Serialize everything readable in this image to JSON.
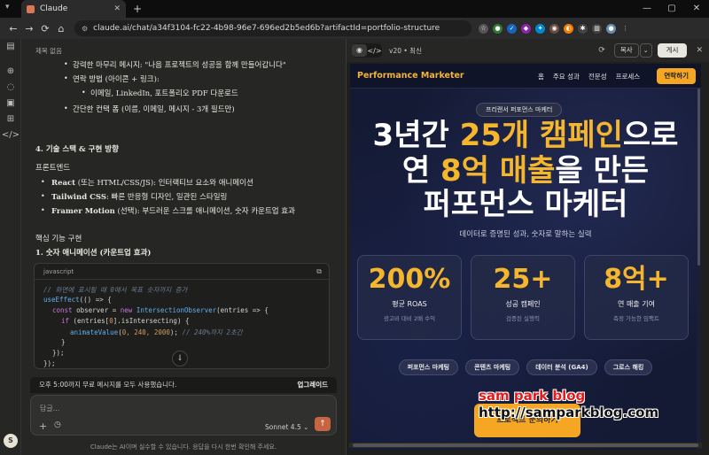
{
  "browser": {
    "tab_title": "Claude",
    "url": "claude.ai/chat/a34f3104-fc22-4b98-96e7-696ed2b5ed6b?artifactId=portfolio-structure"
  },
  "chat": {
    "lines": {
      "untitled": "제목 없음",
      "cta_message": "강력한 마무리 메시지: \"나음 프로젝트의 성공을 함께 만들어갑니다\"",
      "contact_method": "연락 방법 (아이콘 + 링크):",
      "contact_links": "이메일, LinkedIn, 포트폴리오 PDF 다운로드",
      "contact_form": "간단한 컨택 폼 (이름, 이메일, 메시지 - 3개 필드만)",
      "section4": "4. 기술 스택 & 구현 방향",
      "frontend": "프론트엔드",
      "react_b": "React",
      "react_t": " (또는 HTML/CSS/JS): 인터랙티브 요소와 애니메이션",
      "tailwind_b": "Tailwind CSS",
      "tailwind_t": ": 빠른 반응형 디자인, 일관된 스타일링",
      "framer_b": "Framer Motion",
      "framer_t": " (선택): 부드러운 스크롤 애니메이션, 숫자 카운트업 효과",
      "core_impl": "핵심 기능 구현",
      "number_anim": "1. 숫자 애니메이션 (카운트업 효과)"
    },
    "code": {
      "lang": "javascript",
      "l1": "// 화면에 표시될 때 0에서 목표 숫자까지 증가",
      "l2a": "useEffect",
      "l2b": "(() => {",
      "l3a": "const",
      "l3b": " observer = ",
      "l3c": "new",
      "l3d": " IntersectionObserver",
      "l3e": "(entries => {",
      "l4a": "if",
      "l4b": " (entries[",
      "l4c": "0",
      "l4d": "].isIntersecting) {",
      "l5a": "animateValue",
      "l5b": "(",
      "l5c": "0, 240, 2000",
      "l5d": "); ",
      "l5e": "// 240%까지 2초간",
      "l6": "}",
      "l7": "});",
      "l8": "});"
    },
    "banner_text": "오후 5:00까지 무료 메시지를 모두 사용했습니다.",
    "upgrade_label": "업그레이드",
    "input_placeholder": "답글...",
    "model_label": "Sonnet 4.5",
    "disclaimer": "Claude는 AI이며 실수할 수 있습니다. 응답을 다시 한번 확인해 주세요.",
    "avatar_letter": "S"
  },
  "artifact": {
    "version": "v20 • 최신",
    "copy_label": "복사",
    "publish_label": "게시"
  },
  "site": {
    "brand": "Performance Marketer",
    "nav": [
      "홈",
      "주요 성과",
      "전문성",
      "프로세스"
    ],
    "contact": "연락하기",
    "pill": "프리랜서 퍼포먼스 마케터",
    "hero": {
      "l1a": "3년간 ",
      "l1b": "25개 캠페인",
      "l1c": "으로",
      "l2a": "연 ",
      "l2b": "8억 매출",
      "l2c": "을 만든",
      "l3": "퍼포먼스 마케터"
    },
    "subtitle": "데이터로 증명된 성과, 숫자로 말하는 실력",
    "stats": [
      {
        "value": "200%",
        "label": "평균 ROAS",
        "sub": "광고비 대비 2배 수익"
      },
      {
        "value": "25+",
        "label": "성공 캠페인",
        "sub": "검증된 실행력"
      },
      {
        "value": "8억+",
        "label": "연 매출 기여",
        "sub": "측정 가능한 임팩트"
      }
    ],
    "tags": [
      "퍼포먼스 마케팅",
      "콘텐츠 마케팅",
      "데이터 분석 (GA4)",
      "그로스 해킹"
    ],
    "cta": "프로젝트 문의하기"
  },
  "watermark": {
    "line1": "sam park blog",
    "line2": "http://samparkblog.com"
  }
}
